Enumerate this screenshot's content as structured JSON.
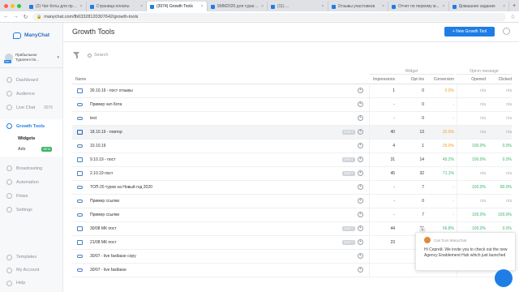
{
  "browser": {
    "tabs": [
      {
        "label": "(2) Чат-боты для привлечения",
        "active": false
      },
      {
        "label": "Страница оплаты",
        "active": false
      },
      {
        "label": "(3074) Growth Tools",
        "active": true
      },
      {
        "label": "SMM2020 для турагентств",
        "active": false
      },
      {
        "label": "(11) ...",
        "active": false
      },
      {
        "label": "Отзывы участников",
        "active": false
      },
      {
        "label": "Отчет по первому м...",
        "active": false
      },
      {
        "label": "Домашнее задание",
        "active": false
      }
    ],
    "url": "manychat.com/fb63328120307642/growth-tools"
  },
  "sidebar": {
    "brand": "ManyChat",
    "account": {
      "line1": "Прибыльное",
      "line2": "Турагентств...",
      "badge": "PRO"
    },
    "nav": [
      {
        "label": "Dashboard",
        "icon": "dashboard-icon"
      },
      {
        "label": "Audience",
        "icon": "audience-icon"
      },
      {
        "label": "Live Chat",
        "icon": "live-chat-icon",
        "count": "3076"
      }
    ],
    "growth_tools": {
      "label": "Growth Tools",
      "icon": "growth-tools-icon"
    },
    "sub": [
      {
        "label": "Widgets"
      },
      {
        "label": "Ads",
        "badge": "BETA"
      }
    ],
    "nav2": [
      {
        "label": "Broadcasting",
        "icon": "broadcasting-icon"
      },
      {
        "label": "Automation",
        "icon": "automation-icon"
      },
      {
        "label": "Flows",
        "icon": "flows-icon"
      },
      {
        "label": "Settings",
        "icon": "settings-icon"
      }
    ],
    "bottom": [
      {
        "label": "Templates",
        "icon": "templates-icon"
      },
      {
        "label": "My Account",
        "icon": "account-icon"
      },
      {
        "label": "Help",
        "icon": "help-icon"
      }
    ]
  },
  "header": {
    "title": "Growth Tools",
    "new_button": "+ New Growth Tool"
  },
  "search": {
    "placeholder": "Search"
  },
  "table": {
    "group_widget": "Widget",
    "group_optin": "Opt-in message",
    "columns": {
      "name": "Name",
      "impressions": "Impressions",
      "optins": "Opt-Ins",
      "conversion": "Conversion",
      "opened": "Opened",
      "clicked": "Clicked"
    },
    "rows": [
      {
        "icon": "rect",
        "name": "30.10.19 - пост отзывы",
        "tag": "",
        "imp": "1",
        "opt": "0",
        "conv": "0.0%",
        "conv_color": "orange",
        "opened": "n/a",
        "clicked": "n/a"
      },
      {
        "icon": "link",
        "name": "Пример чат-бота",
        "tag": "",
        "imp": "-",
        "opt": "0",
        "conv": "-",
        "conv_color": "muted",
        "opened": "n/a",
        "clicked": "n/a"
      },
      {
        "icon": "link",
        "name": "test",
        "tag": "",
        "imp": "-",
        "opt": "0",
        "conv": "-",
        "conv_color": "muted",
        "opened": "n/a",
        "clicked": "n/a"
      },
      {
        "icon": "rect-sel",
        "name": "18.10.19 - повтор",
        "tag": "DRAFT",
        "imp": "40",
        "opt": "13",
        "conv": "32.5%",
        "conv_color": "orange",
        "opened": "n/a",
        "clicked": "n/a"
      },
      {
        "icon": "link",
        "name": "10.10.19",
        "tag": "",
        "imp": "4",
        "opt": "1",
        "conv": "25.0%",
        "conv_color": "orange",
        "opened": "100.0%",
        "clicked": "0.0%"
      },
      {
        "icon": "rect",
        "name": "9.10.19 - пост",
        "tag": "DRAFT",
        "imp": "31",
        "opt": "14",
        "conv": "45.2%",
        "conv_color": "green",
        "opened": "100.0%",
        "clicked": "0.0%"
      },
      {
        "icon": "rect",
        "name": "2.10.19 пост",
        "tag": "DRAFT",
        "imp": "45",
        "opt": "32",
        "conv": "71.1%",
        "conv_color": "green",
        "opened": "n/a",
        "clicked": "n/a"
      },
      {
        "icon": "link",
        "name": "ТОП-20 туров на Новый год 2020",
        "tag": "",
        "imp": "-",
        "opt": "7",
        "conv": "-",
        "conv_color": "muted",
        "opened": "100.0%",
        "clicked": "80.0%"
      },
      {
        "icon": "link",
        "name": "Пример ссылки",
        "tag": "",
        "imp": "-",
        "opt": "0",
        "conv": "-",
        "conv_color": "muted",
        "opened": "n/a",
        "clicked": "n/a"
      },
      {
        "icon": "link",
        "name": "Пример ссылки",
        "tag": "",
        "imp": "-",
        "opt": "7",
        "conv": "-",
        "conv_color": "muted",
        "opened": "100.0%",
        "clicked": "100.0%"
      },
      {
        "icon": "rect",
        "name": "30/08 МК пост",
        "tag": "DRAFT",
        "imp": "44",
        "opt": "25",
        "conv": "56.8%",
        "conv_color": "green",
        "opened": "100.0%",
        "clicked": "0.0%"
      },
      {
        "icon": "rect",
        "name": "21/08 МК пост",
        "tag": "DRAFT",
        "imp": "23",
        "opt": "",
        "conv": "",
        "conv_color": "muted",
        "opened": "",
        "clicked": ""
      },
      {
        "icon": "link",
        "name": "30/07 - live fastbase copy",
        "tag": "",
        "imp": "",
        "opt": "",
        "conv": "",
        "conv_color": "muted",
        "opened": "",
        "clicked": ""
      },
      {
        "icon": "link",
        "name": "30/07 - live fastbase",
        "tag": "",
        "imp": "",
        "opt": "",
        "conv": "",
        "conv_color": "muted",
        "opened": "",
        "clicked": ""
      }
    ]
  },
  "chat": {
    "from": "Cari from ManyChat",
    "line1": "Hi Сергей. We invite you to check out the new",
    "line2": "Agency Enablement Hub which just launched"
  },
  "colors": {
    "accent": "#1f7de6",
    "green": "#3bb56a",
    "orange": "#f0a020"
  }
}
